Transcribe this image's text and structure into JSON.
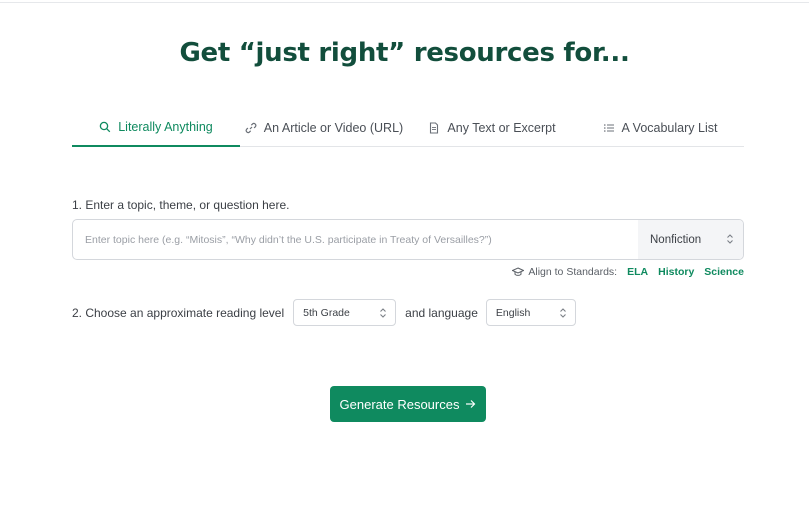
{
  "heading": "Get “just right” resources for...",
  "tabs": [
    {
      "label": "Literally Anything",
      "icon": "search-icon",
      "active": true
    },
    {
      "label": "An Article or Video (URL)",
      "icon": "link-icon",
      "active": false
    },
    {
      "label": "Any Text or Excerpt",
      "icon": "document-icon",
      "active": false
    },
    {
      "label": "A Vocabulary List",
      "icon": "list-icon",
      "active": false
    }
  ],
  "step1": {
    "label": "1. Enter a topic, theme, or question here.",
    "placeholder": "Enter topic here (e.g. “Mitosis”, “Why didn’t the U.S. participate in Treaty of Versailles?”)",
    "value": "",
    "genre": "Nonfiction"
  },
  "standards": {
    "label": "Align to Standards:",
    "icon": "graduation-cap-icon",
    "links": [
      "ELA",
      "History",
      "Science"
    ]
  },
  "step2": {
    "label": "2. Choose an approximate reading level",
    "level": "5th Grade",
    "language_label": "and language",
    "language": "English"
  },
  "generate": {
    "label": "Generate Resources",
    "icon": "arrow-right-icon"
  },
  "colors": {
    "accent": "#0f8a5f",
    "heading": "#124e3c"
  }
}
